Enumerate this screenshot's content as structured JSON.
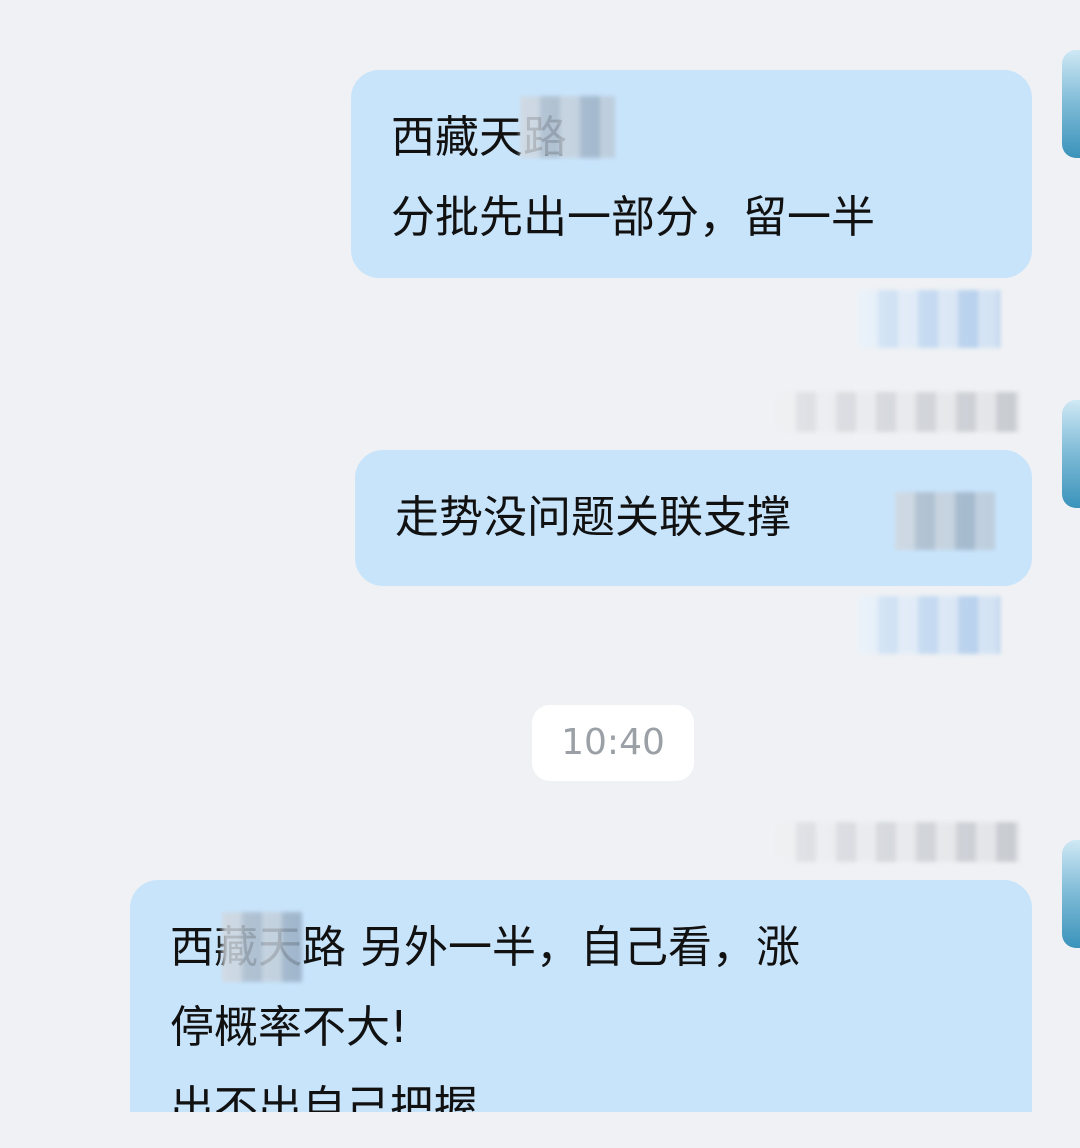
{
  "messages": [
    {
      "lines": [
        "西藏天路",
        "分批先出一部分，留一半"
      ]
    },
    {
      "lines": [
        "走势没问题关联支撑"
      ]
    },
    {
      "lines": [
        "西藏天路   另外一半，自己看，涨",
        "停概率不大!",
        "出不出自己把握"
      ]
    }
  ],
  "time_separator": "10:40",
  "colors": {
    "background": "#eff1f4",
    "bubble": "#c8e4fb",
    "time_chip": "#ffffff",
    "time_text": "#9aa0a6"
  }
}
